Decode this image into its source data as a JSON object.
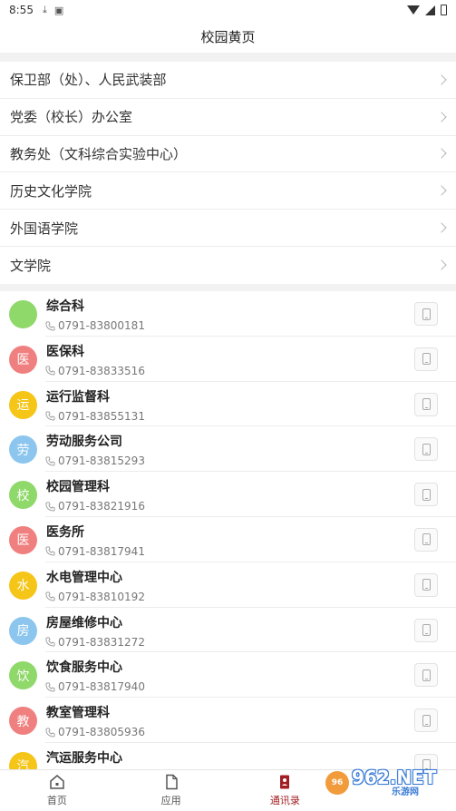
{
  "status_bar": {
    "time": "8:55"
  },
  "header": {
    "title": "校园黄页"
  },
  "departments": [
    {
      "label": "保卫部（处）、人民武装部"
    },
    {
      "label": "党委（校长）办公室"
    },
    {
      "label": "教务处（文科综合实验中心）"
    },
    {
      "label": "历史文化学院"
    },
    {
      "label": "外国语学院"
    },
    {
      "label": "文学院"
    }
  ],
  "contacts": [
    {
      "avatar": "",
      "color": "#8fd86a",
      "name": "综合科",
      "phone": "0791-83800181"
    },
    {
      "avatar": "医",
      "color": "#f08080",
      "name": "医保科",
      "phone": "0791-83833516"
    },
    {
      "avatar": "运",
      "color": "#f5c518",
      "name": "运行监督科",
      "phone": "0791-83855131"
    },
    {
      "avatar": "劳",
      "color": "#8cc6ee",
      "name": "劳动服务公司",
      "phone": "0791-83815293"
    },
    {
      "avatar": "校",
      "color": "#8fd86a",
      "name": "校园管理科",
      "phone": "0791-83821916"
    },
    {
      "avatar": "医",
      "color": "#f08080",
      "name": "医务所",
      "phone": "0791-83817941"
    },
    {
      "avatar": "水",
      "color": "#f5c518",
      "name": "水电管理中心",
      "phone": "0791-83810192"
    },
    {
      "avatar": "房",
      "color": "#8cc6ee",
      "name": "房屋维修中心",
      "phone": "0791-83831272"
    },
    {
      "avatar": "饮",
      "color": "#8fd86a",
      "name": "饮食服务中心",
      "phone": "0791-83817940"
    },
    {
      "avatar": "教",
      "color": "#f08080",
      "name": "教室管理科",
      "phone": "0791-83805936"
    },
    {
      "avatar": "汽",
      "color": "#f5c518",
      "name": "汽运服务中心",
      "phone": ""
    }
  ],
  "bottom_nav": [
    {
      "label": "首页",
      "icon": "home-icon"
    },
    {
      "label": "应用",
      "icon": "document-icon"
    },
    {
      "label": "通讯录",
      "icon": "contacts-icon",
      "active": true
    },
    {
      "label": "",
      "icon": "profile-icon"
    }
  ],
  "watermark": {
    "big_text": "962.NET",
    "small_text": "乐游网"
  },
  "colors": {
    "accent": "#a31e22",
    "background": "#f2f2f2"
  }
}
